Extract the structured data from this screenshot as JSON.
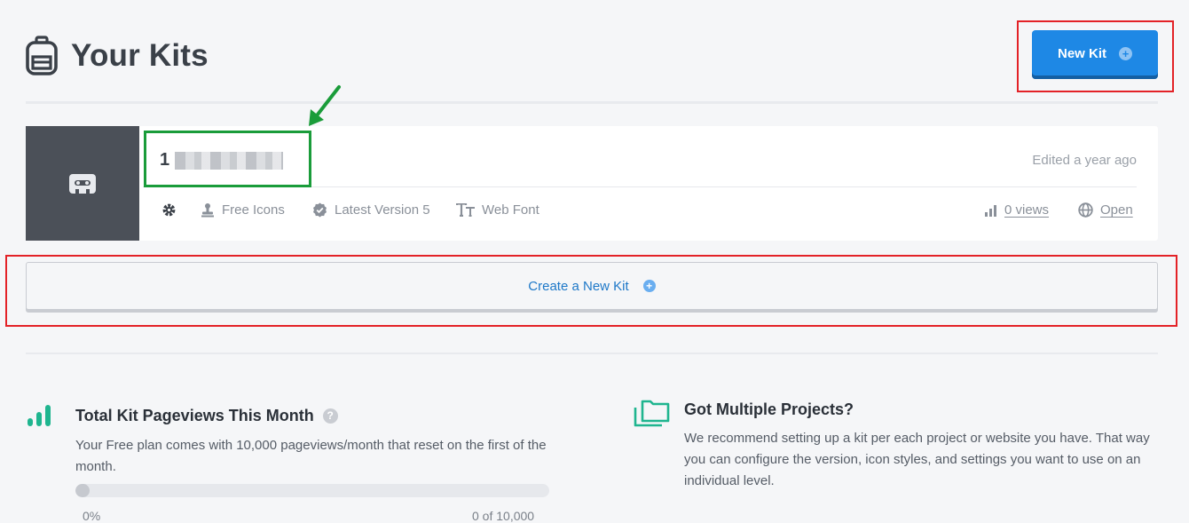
{
  "header": {
    "title": "Your Kits",
    "new_kit_label": "New Kit"
  },
  "kit": {
    "name_visible": "1",
    "edited": "Edited a year ago",
    "meta": {
      "plan": "Free Icons",
      "version": "Latest Version 5",
      "tech": "Web Font",
      "views": "0 views",
      "open": "Open"
    }
  },
  "create_kit_label": "Create a New Kit",
  "pageviews": {
    "title": "Total Kit Pageviews This Month",
    "desc": "Your Free plan comes with 10,000 pageviews/month that reset on the first of the month.",
    "percent_label": "0%",
    "count_label": "0 of 10,000",
    "fill_fraction": 0.03
  },
  "projects": {
    "title": "Got Multiple Projects?",
    "desc": "We recommend setting up a kit per each project or website you have. That way you can configure the version, icon styles, and settings you want to use on an individual level."
  },
  "colors": {
    "primary": "#1e88e5",
    "annotation_red": "#e32227",
    "annotation_green": "#1a9c3a",
    "teal": "#1fb58f"
  }
}
